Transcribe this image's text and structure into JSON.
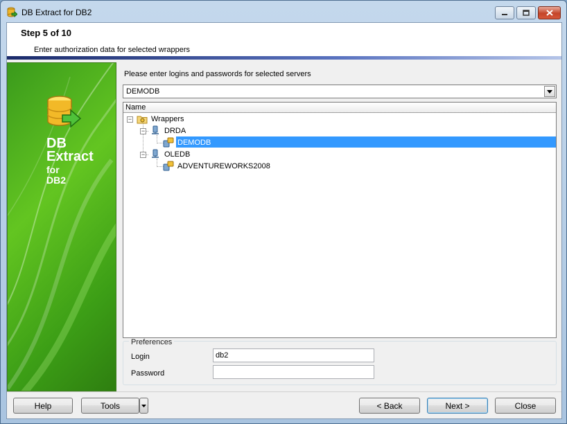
{
  "window": {
    "title": "DB Extract for DB2"
  },
  "header": {
    "step": "Step 5 of 10",
    "subtitle": "Enter authorization data for selected wrappers"
  },
  "banner": {
    "line1": "DB",
    "line2": "Extract",
    "line3": "for",
    "line4": "DB2"
  },
  "main": {
    "prompt": "Please enter logins and passwords for selected servers",
    "server_select": {
      "value": "DEMODB"
    },
    "tree": {
      "column": "Name",
      "nodes": [
        {
          "label": "Wrappers",
          "level": 0,
          "expanded": true,
          "icon": "folder-icon"
        },
        {
          "label": "DRDA",
          "level": 1,
          "expanded": true,
          "icon": "wrapper-icon"
        },
        {
          "label": "DEMODB",
          "level": 2,
          "selected": true,
          "icon": "server-icon"
        },
        {
          "label": "OLEDB",
          "level": 1,
          "expanded": true,
          "icon": "wrapper-icon"
        },
        {
          "label": "ADVENTUREWORKS2008",
          "level": 2,
          "icon": "server-icon"
        }
      ]
    },
    "preferences": {
      "title": "Preferences",
      "login_label": "Login",
      "login_value": "db2",
      "password_label": "Password",
      "password_value": ""
    }
  },
  "footer": {
    "help": "Help",
    "tools": "Tools",
    "back": "< Back",
    "next": "Next >",
    "close": "Close"
  },
  "colors": {
    "selection": "#3399ff",
    "banner_green": "#63c521",
    "header_bar": "#1a2a6a"
  }
}
